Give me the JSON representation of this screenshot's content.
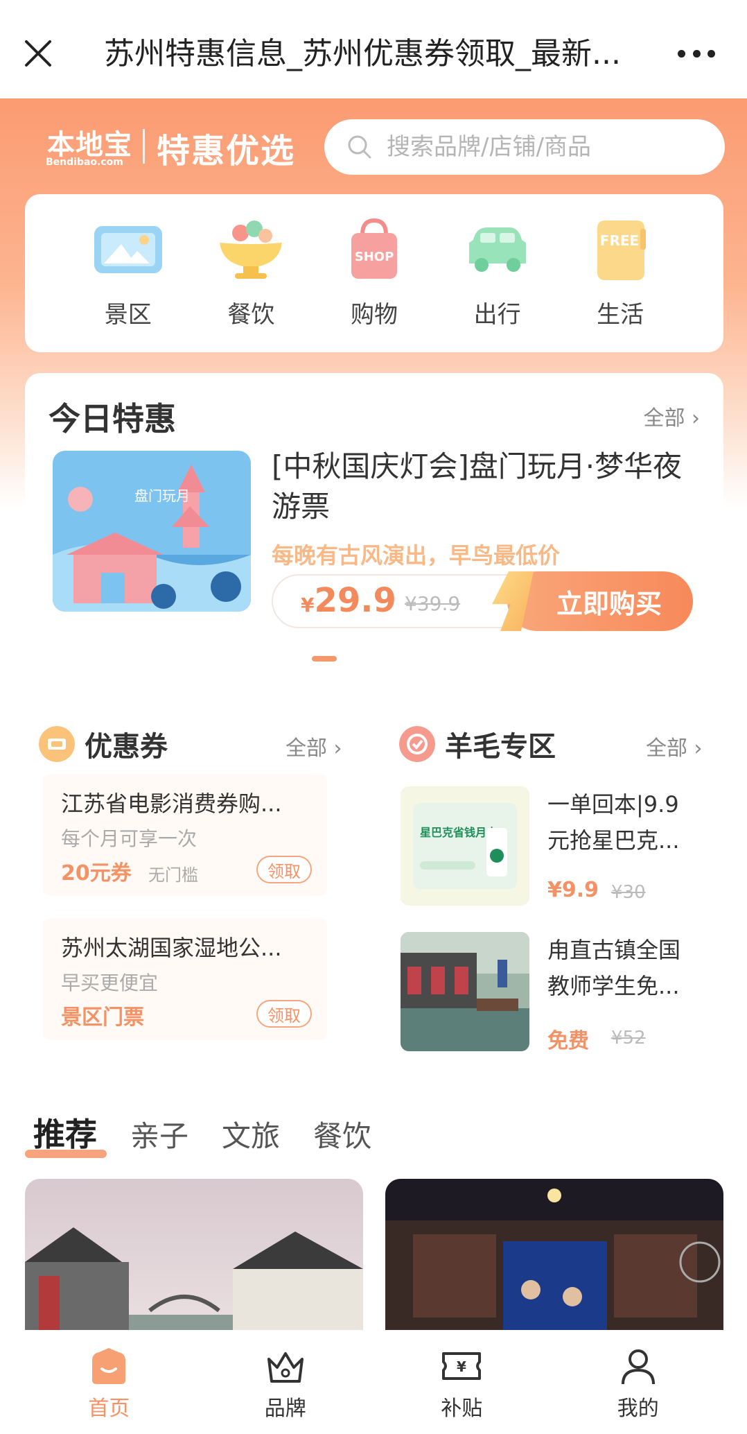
{
  "topbar": {
    "title": "苏州特惠信息_苏州优惠券领取_最新...",
    "close_icon": "close-icon",
    "more_icon": "more-icon"
  },
  "brand": {
    "logo_main": "本地宝",
    "logo_sub": "Bendibao.com",
    "slogan": "特惠优选"
  },
  "search": {
    "placeholder": "搜索品牌/店铺/商品"
  },
  "categories": [
    {
      "label": "景区",
      "icon": "scenic-icon"
    },
    {
      "label": "餐饮",
      "icon": "food-bowl-icon"
    },
    {
      "label": "购物",
      "icon": "shopping-bag-icon"
    },
    {
      "label": "出行",
      "icon": "car-icon"
    },
    {
      "label": "生活",
      "icon": "life-notebook-icon"
    }
  ],
  "today": {
    "title": "今日特惠",
    "all": "全部",
    "product_title": "[中秋国庆灯会]盘门玩月·梦华夜游票",
    "product_desc": "每晚有古风演出，早鸟最低价",
    "currency": "¥",
    "price": "29.9",
    "orig_price": "¥39.9",
    "buy": "立即购买",
    "thumb_caption": "盘门玩月"
  },
  "coupons": {
    "title": "优惠券",
    "all": "全部",
    "items": [
      {
        "name": "江苏省电影消费券购...",
        "desc": "每个月可享一次",
        "value": "20元券",
        "note": "无门槛",
        "btn": "领取"
      },
      {
        "name": "苏州太湖国家湿地公...",
        "desc": "早买更便宜",
        "value": "景区门票",
        "note": "",
        "btn": "领取"
      }
    ]
  },
  "sheep": {
    "title": "羊毛专区",
    "all": "全部",
    "items": [
      {
        "name": "一单回本|9.9元抢星巴克...",
        "price": "¥9.9",
        "orig": "¥30",
        "img_caption": "星巴克省钱月卡"
      },
      {
        "name": "甪直古镇全国教师学生免...",
        "price": "免费",
        "orig": "¥52"
      }
    ]
  },
  "tabs": [
    "推荐",
    "亲子",
    "文旅",
    "餐饮"
  ],
  "bottom_nav": [
    {
      "label": "首页",
      "icon": "home-icon"
    },
    {
      "label": "品牌",
      "icon": "crown-icon"
    },
    {
      "label": "补贴",
      "icon": "coupon-ticket-icon"
    },
    {
      "label": "我的",
      "icon": "user-icon"
    }
  ],
  "colors": {
    "accent": "#f49266",
    "hero": "#fb9b72"
  }
}
